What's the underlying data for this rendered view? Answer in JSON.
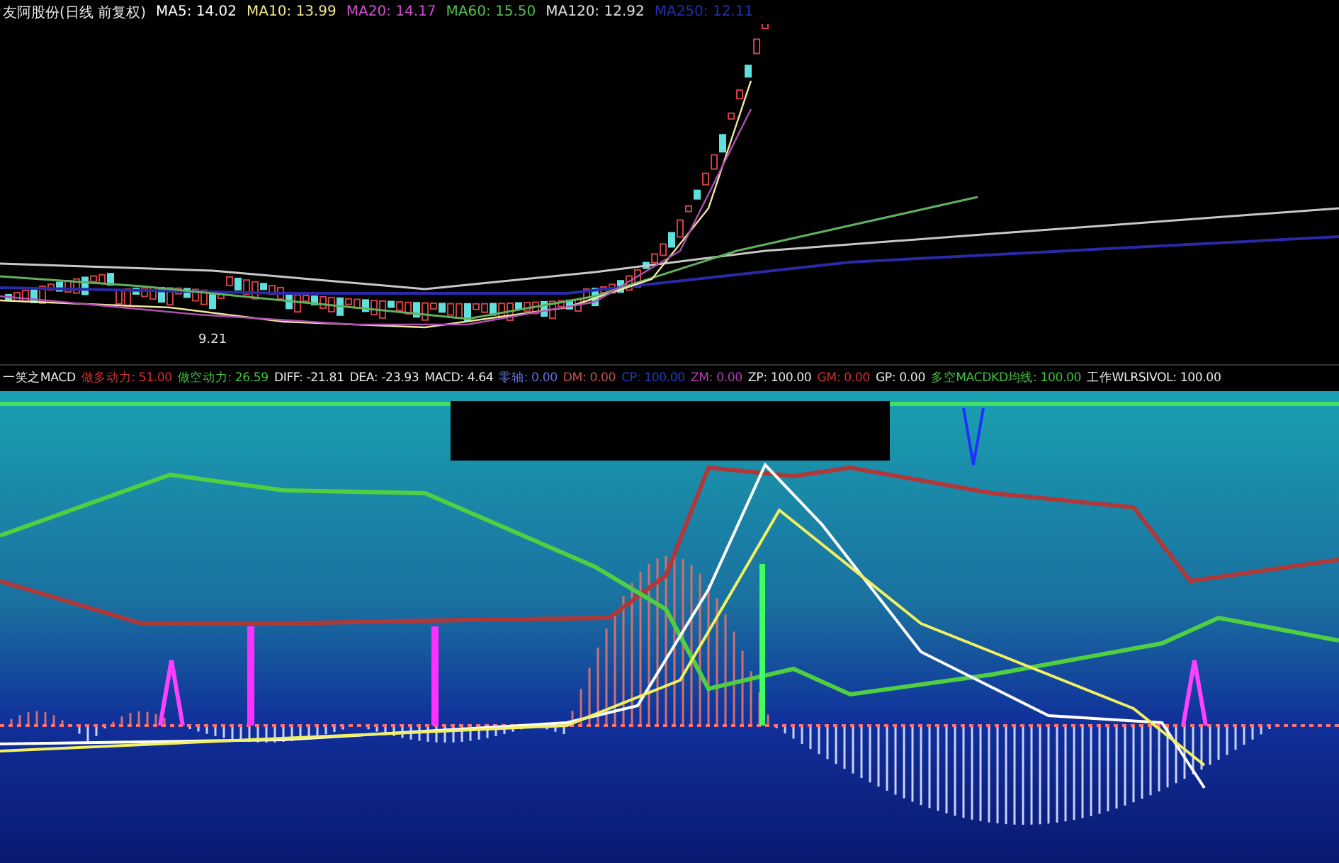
{
  "price_panel": {
    "title": "友阿股份(日线 前复权)",
    "indicators": [
      {
        "text": "MA5: 14.02",
        "color": "#ffffff"
      },
      {
        "text": "MA10: 13.99",
        "color": "#f0e68c"
      },
      {
        "text": "MA20: 14.17",
        "color": "#d050d0"
      },
      {
        "text": "MA60: 15.50",
        "color": "#50c050"
      },
      {
        "text": "MA120: 12.92",
        "color": "#e0e0e0"
      },
      {
        "text": "MA250: 12.11",
        "color": "#2030b0"
      }
    ],
    "low_label": "9.21"
  },
  "indicator_panel": {
    "title": "一笑之MACD",
    "indicators": [
      {
        "text": "做多动力: 51.00",
        "color": "#d03030"
      },
      {
        "text": "做空动力: 26.59",
        "color": "#40c040"
      },
      {
        "text": "DIFF: -21.81",
        "color": "#e8e8e8"
      },
      {
        "text": "DEA: -23.93",
        "color": "#e8e8e8"
      },
      {
        "text": "MACD: 4.64",
        "color": "#e8e8e8"
      },
      {
        "text": "零轴: 0.00",
        "color": "#6070e0"
      },
      {
        "text": "DM: 0.00",
        "color": "#c05050"
      },
      {
        "text": "CP: 100.00",
        "color": "#2040c0"
      },
      {
        "text": "ZM: 0.00",
        "color": "#b040b0"
      },
      {
        "text": "ZP: 100.00",
        "color": "#e8e8e8"
      },
      {
        "text": "GM: 0.00",
        "color": "#d03030"
      },
      {
        "text": "GP: 0.00",
        "color": "#e8e8e8"
      },
      {
        "text": "多空MACDKD均线: 100.00",
        "color": "#40c040"
      },
      {
        "text": "工作WLRSIVOL: 100.00",
        "color": "#e8e8e8"
      }
    ]
  }
}
